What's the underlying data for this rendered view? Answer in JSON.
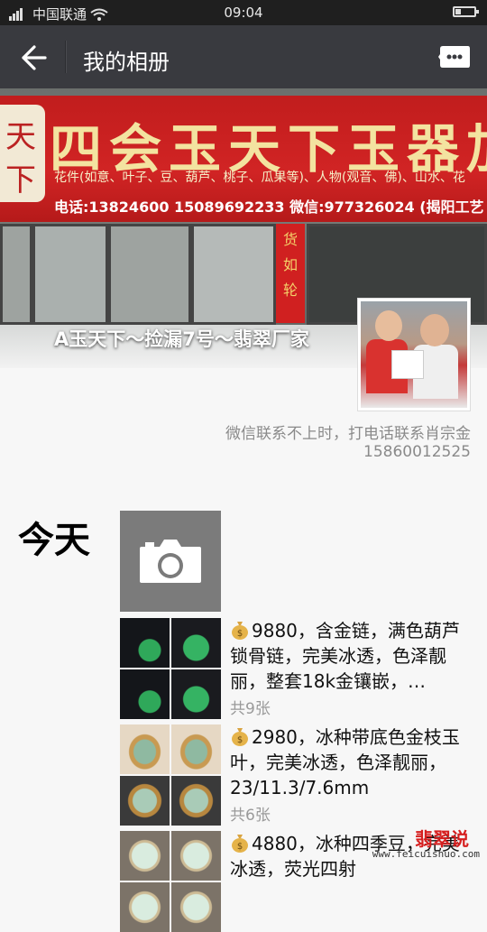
{
  "status_bar": {
    "carrier": "中国联通",
    "time": "09:04",
    "battery_level": 0.35
  },
  "header": {
    "title": "我的相册"
  },
  "cover": {
    "sign_main": "四会玉天下玉器加工",
    "sign_sub": "花件(如意、叶子、豆、葫芦、桃子、瓜果等)、人物(观音、佛)、山水、花",
    "sign_phone": "电话:13824600 15089692233 微信:977326024 (揭阳工艺",
    "logo_text": [
      "天",
      "下"
    ],
    "banner_text": [
      "货",
      "如",
      "轮"
    ],
    "album_name": "A玉天下～捡漏7号～翡翠厂家"
  },
  "profile": {
    "signature": "微信联系不上时，打电话联系肖宗金",
    "phone": "15860012525"
  },
  "feed": {
    "day_label": "今天",
    "posts": [
      {
        "text": "9880，含金链，满色葫芦锁骨链，完美冰透，色泽靓丽，整套18k金镶嵌，…",
        "count": "共9张",
        "thumbs": [
          "t-dark",
          "t-dark2",
          "t-dark",
          "t-dark2"
        ]
      },
      {
        "text": "2980，冰种带底色金枝玉叶，完美冰透，色泽靓丽，23/11.3/7.6mm",
        "count": "共6张",
        "thumbs": [
          "t-gold",
          "t-gold",
          "t-gold2",
          "t-gold2"
        ]
      },
      {
        "text": "4880，冰种四季豆，完美冰透，荧光四射",
        "count": "",
        "thumbs": [
          "t-light",
          "t-light",
          "t-light",
          "t-light"
        ]
      }
    ]
  },
  "watermark": {
    "brand": "翡翠说",
    "url": "www.feicuishuo.com"
  },
  "colors": {
    "topbar": "#393a3f",
    "statusbar": "#1f1f1f",
    "sign_red": "#c11d1d"
  }
}
